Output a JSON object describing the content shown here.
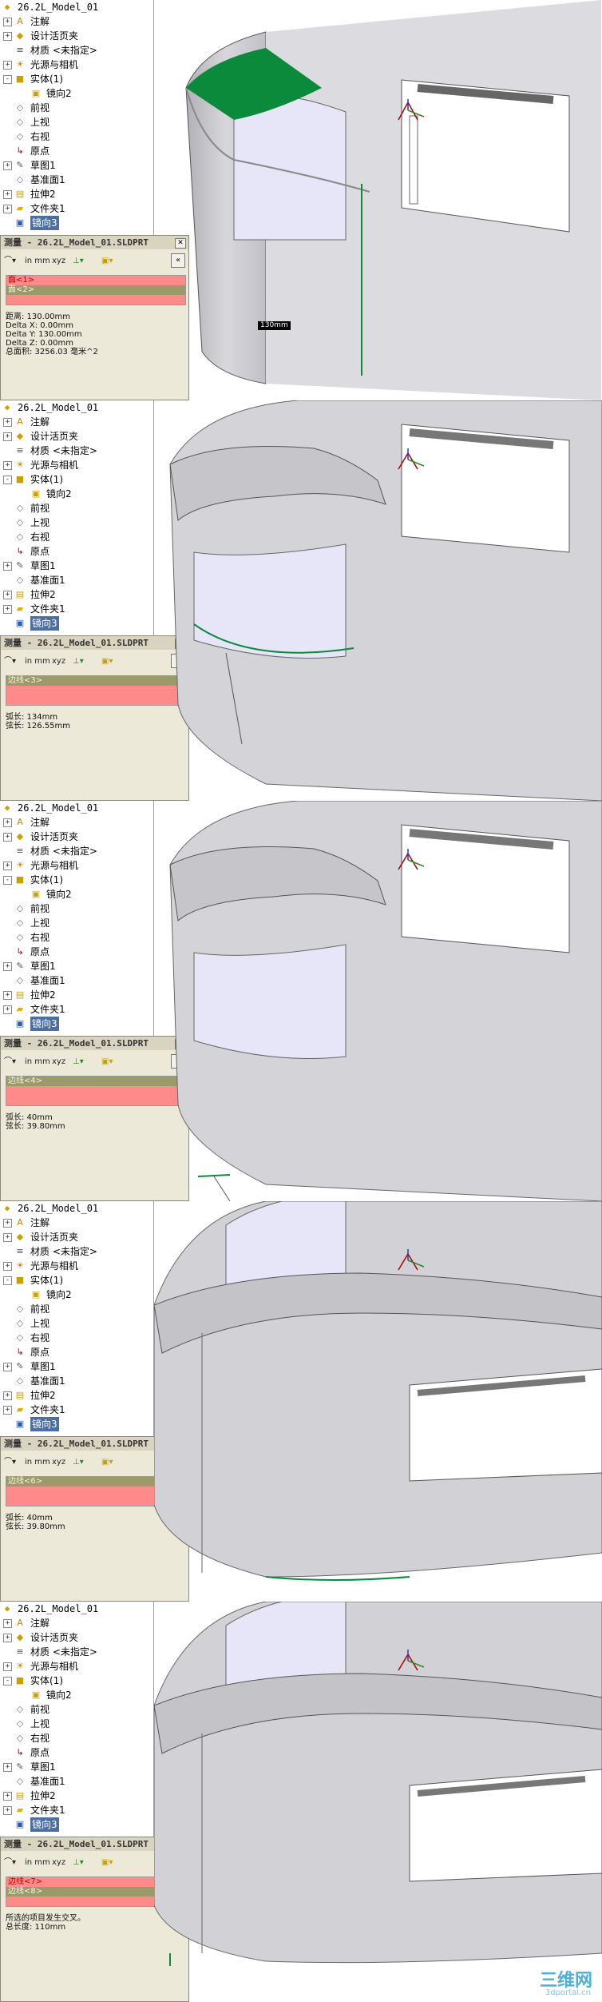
{
  "tree": {
    "root": "26.2L_Model_01",
    "items": [
      {
        "label": "注解",
        "icon": "annotation-icon"
      },
      {
        "label": "设计活页夹",
        "icon": "binder-icon"
      },
      {
        "label": "材质 <未指定>",
        "icon": "material-icon"
      },
      {
        "label": "光源与相机",
        "icon": "lights-icon"
      },
      {
        "label": "实体(1)",
        "icon": "solid-body-icon"
      },
      {
        "label": "镜向2",
        "icon": "mirror-icon"
      },
      {
        "label": "前视",
        "icon": "plane-icon"
      },
      {
        "label": "上视",
        "icon": "plane-icon"
      },
      {
        "label": "右视",
        "icon": "plane-icon"
      },
      {
        "label": "原点",
        "icon": "origin-icon"
      },
      {
        "label": "草图1",
        "icon": "sketch-icon"
      },
      {
        "label": "基准面1",
        "icon": "plane-icon"
      },
      {
        "label": "拉伸2",
        "icon": "extrude-icon"
      },
      {
        "label": "文件夹1",
        "icon": "folder-icon"
      },
      {
        "label": "镜向3",
        "icon": "mirror-icon"
      }
    ]
  },
  "measure": {
    "title": "测量 - 26.2L_Model_01.SLDPRT",
    "units_label": "in mm",
    "collapse_label": "«"
  },
  "panels": [
    {
      "selections": [
        {
          "label": "面<1>",
          "color": "red"
        },
        {
          "label": "面<2>",
          "color": "olive"
        }
      ],
      "results": [
        "距离: 130.00mm",
        "Delta X: 0.00mm",
        "Delta Y: 130.00mm",
        "Delta Z: 0.00mm",
        "总面积: 3256.03 毫米^2"
      ],
      "dimension": "130mm"
    },
    {
      "selections": [
        {
          "label": "边线<3>",
          "color": "olive"
        }
      ],
      "results": [
        "弧长: 134mm",
        "弦长: 126.55mm"
      ]
    },
    {
      "selections": [
        {
          "label": "边线<4>",
          "color": "olive"
        }
      ],
      "results": [
        "弧长: 40mm",
        "弦长: 39.80mm"
      ]
    },
    {
      "selections": [
        {
          "label": "边线<6>",
          "color": "olive"
        }
      ],
      "results": [
        "弧长: 40mm",
        "弦长: 39.80mm"
      ]
    },
    {
      "selections": [
        {
          "label": "边线<7>",
          "color": "red"
        },
        {
          "label": "边线<8>",
          "color": "olive"
        }
      ],
      "results": [
        "所选的项目发生交叉。",
        "总长度: 110mm"
      ]
    }
  ],
  "watermark": {
    "main": "三维网",
    "sub": "3dportal.cn"
  },
  "colors": {
    "model": "#c9c9cc",
    "highlight": "#0a8a3a",
    "selection_red": "#ff8a8a",
    "panel_bg": "#ece9d8"
  }
}
